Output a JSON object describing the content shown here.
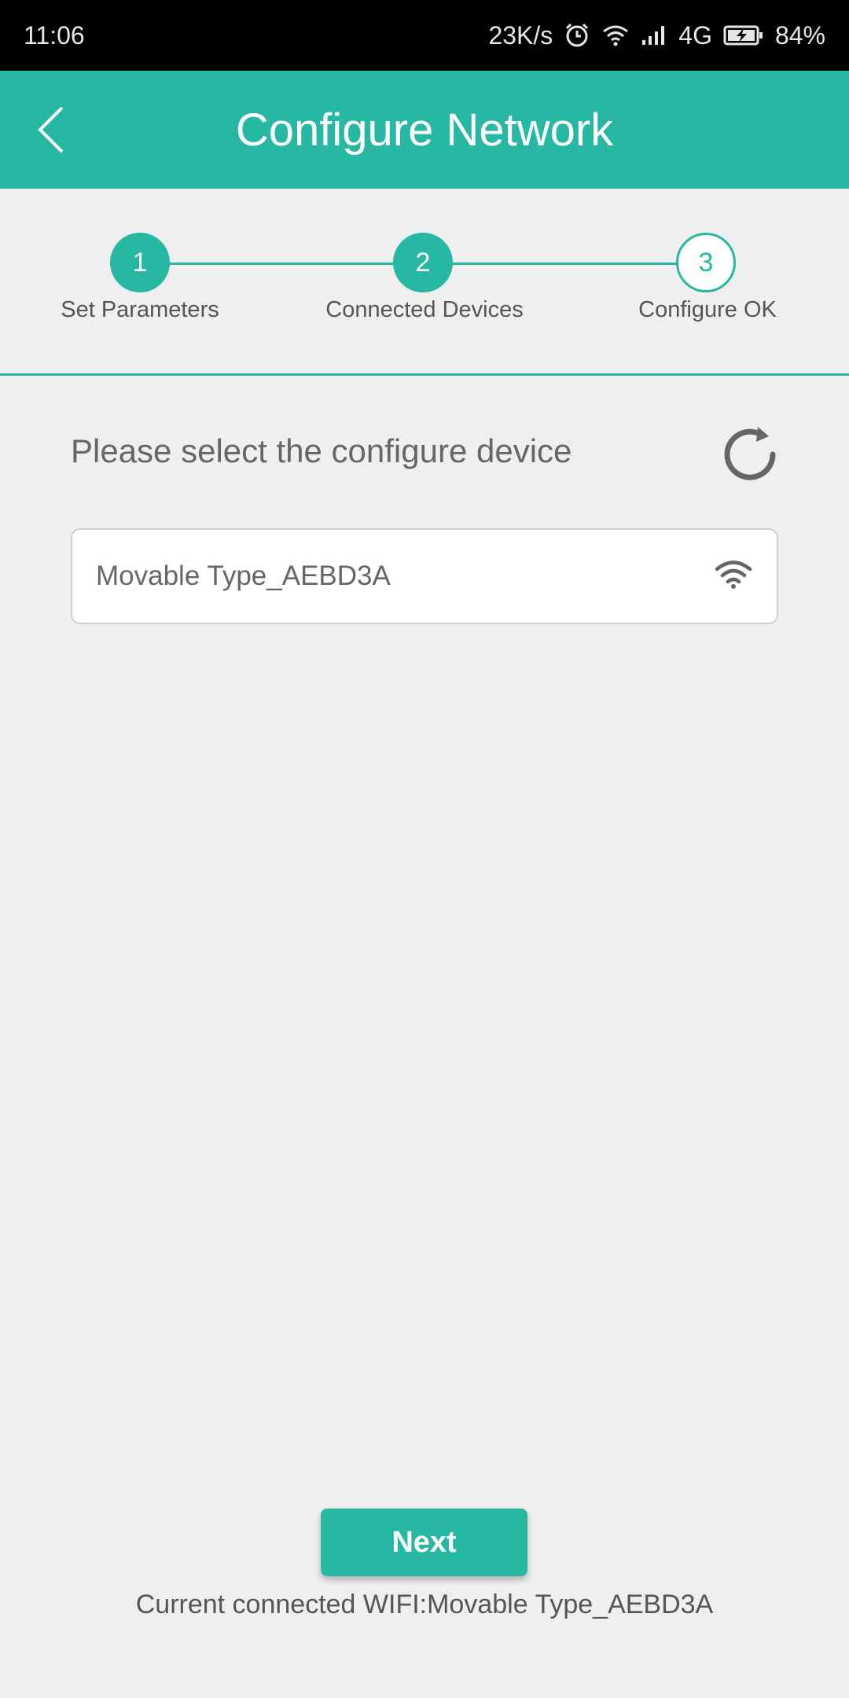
{
  "status_bar": {
    "time": "11:06",
    "speed": "23K/s",
    "network": "4G",
    "battery": "84%",
    "icons": [
      "alarm-icon",
      "wifi-icon",
      "signal-icon",
      "battery-charging-icon"
    ]
  },
  "header": {
    "title": "Configure Network",
    "back_icon": "chevron-left-icon"
  },
  "stepper": {
    "steps": [
      {
        "number": "1",
        "label": "Set Parameters",
        "state": "done"
      },
      {
        "number": "2",
        "label": "Connected Devices",
        "state": "current"
      },
      {
        "number": "3",
        "label": "Configure OK",
        "state": "pending"
      }
    ]
  },
  "main": {
    "heading": "Please select the configure device",
    "refresh_icon": "refresh-icon",
    "devices": [
      {
        "name": "Movable Type_AEBD3A",
        "icon": "wifi-icon"
      }
    ]
  },
  "footer": {
    "next_label": "Next",
    "current_wifi": "Current connected WIFI:Movable Type_AEBD3A"
  },
  "colors": {
    "accent": "#26b8a3",
    "background": "#efefef",
    "status_bar": "#000000"
  }
}
